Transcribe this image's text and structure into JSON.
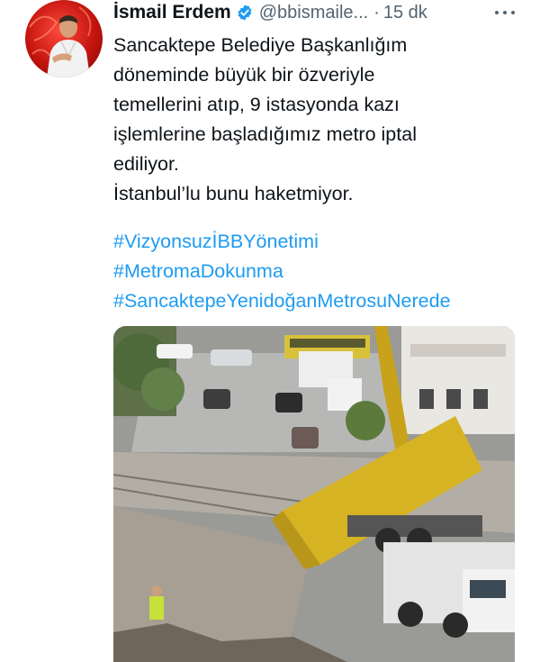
{
  "tweet": {
    "author_name": "İsmail Erdem",
    "handle": "@bbismaile...",
    "separator": "·",
    "time": "15 dk",
    "verified": true,
    "text_lines": [
      "Sancaktepe Belediye Başkanlığım",
      "döneminde büyük bir özveriyle",
      "temellerini atıp, 9 istasyonda kazı",
      "işlemlerine başladığımız metro iptal",
      "ediliyor.",
      "İstanbul’lu bunu haketmiyor."
    ],
    "hashtags": [
      "#VizyonsuzİBBYönetimi",
      "#MetromaDokunma",
      "#SancaktepeYenidoğanMetrosuNerede"
    ]
  },
  "icons": {
    "verified": "verified-badge-icon",
    "more": "more-horizontal-icon"
  },
  "colors": {
    "text": "#0f1419",
    "secondary": "#536471",
    "link": "#1d9bf0",
    "verified": "#1d9bf0"
  }
}
